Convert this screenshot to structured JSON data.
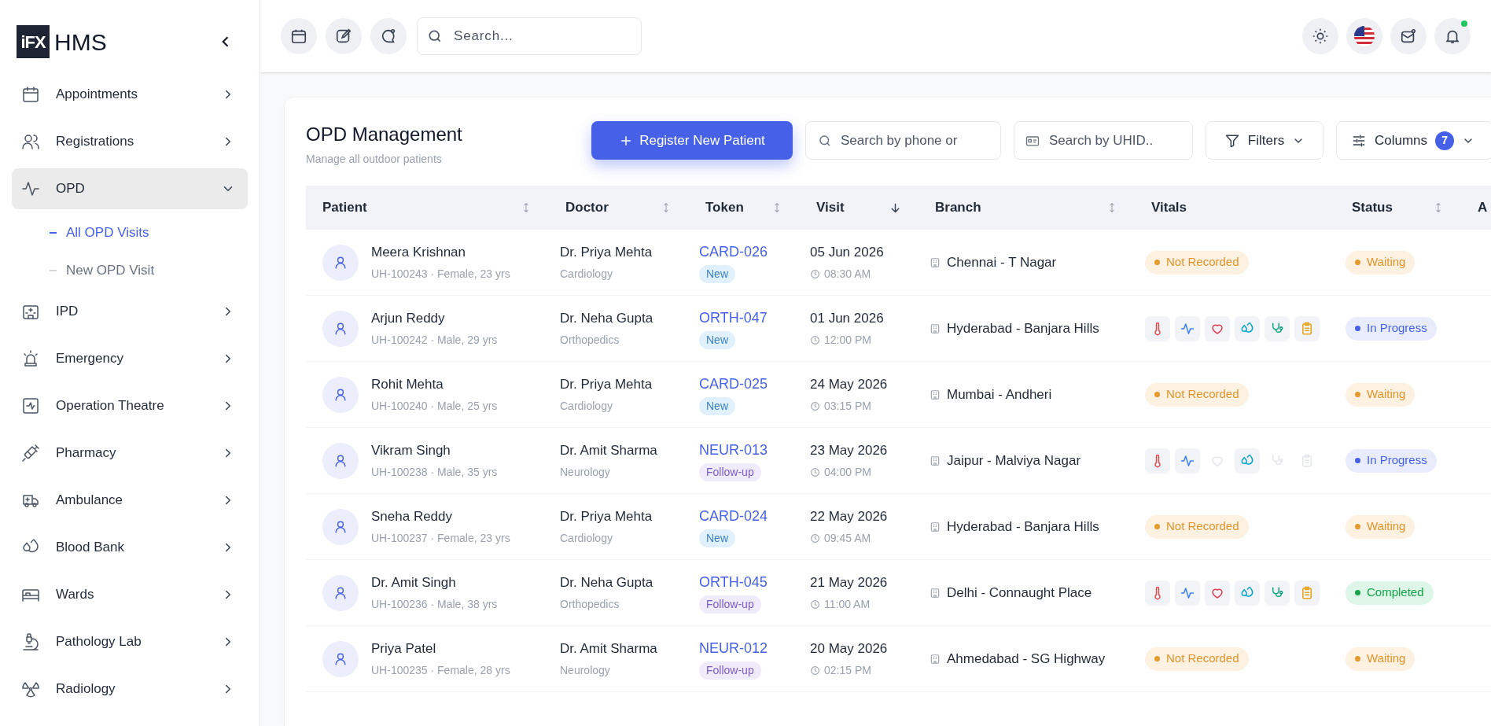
{
  "sidebar": {
    "logo_mark": "iFX",
    "logo_text": "HMS",
    "items": [
      {
        "label": "Appointments",
        "expanded": false
      },
      {
        "label": "Registrations",
        "expanded": false
      },
      {
        "label": "OPD",
        "expanded": true,
        "children": [
          {
            "label": "All OPD Visits",
            "selected": true
          },
          {
            "label": "New OPD Visit",
            "selected": false
          }
        ]
      },
      {
        "label": "IPD",
        "expanded": false
      },
      {
        "label": "Emergency",
        "expanded": false
      },
      {
        "label": "Operation Theatre",
        "expanded": false
      },
      {
        "label": "Pharmacy",
        "expanded": false
      },
      {
        "label": "Ambulance",
        "expanded": false
      },
      {
        "label": "Blood Bank",
        "expanded": false
      },
      {
        "label": "Wards",
        "expanded": false
      },
      {
        "label": "Pathology Lab",
        "expanded": false
      },
      {
        "label": "Radiology",
        "expanded": false
      }
    ]
  },
  "topbar": {
    "search": {
      "placeholder": "Search..."
    },
    "notification_dot": true
  },
  "page": {
    "title": "OPD Management",
    "subtitle": "Manage all outdoor patients",
    "register_button": "Register New Patient",
    "phone_search": {
      "placeholder": "Search by phone or"
    },
    "uhid_search": {
      "placeholder": "Search by UHID.."
    },
    "filters_button": "Filters",
    "columns_button": "Columns",
    "columns_count": "7"
  },
  "table": {
    "columns": [
      {
        "label": "Patient",
        "sortable": true,
        "sorted": false
      },
      {
        "label": "Doctor",
        "sortable": true,
        "sorted": false
      },
      {
        "label": "Token",
        "sortable": true,
        "sorted": false
      },
      {
        "label": "Visit",
        "sortable": true,
        "sorted": true
      },
      {
        "label": "Branch",
        "sortable": true,
        "sorted": false
      },
      {
        "label": "Vitals",
        "sortable": false,
        "sorted": false
      },
      {
        "label": "Status",
        "sortable": true,
        "sorted": false
      },
      {
        "label": "A",
        "sortable": false,
        "sorted": false
      }
    ],
    "rows": [
      {
        "name": "Meera Krishnan",
        "info": "UH-100243 · Female, 23 yrs",
        "doctor": "Dr. Priya Mehta",
        "department": "Cardiology",
        "token": "CARD-026",
        "visit_type": {
          "label": "New",
          "kind": "new"
        },
        "date": "05 Jun 2026",
        "time": "08:30 AM",
        "branch": "Chennai - T Nagar",
        "vitals": {
          "kind": "badge",
          "label": "Not Recorded"
        },
        "status": {
          "label": "Waiting",
          "kind": "waiting"
        }
      },
      {
        "name": "Arjun Reddy",
        "info": "UH-100242 · Male, 29 yrs",
        "doctor": "Dr. Neha Gupta",
        "department": "Orthopedics",
        "token": "ORTH-047",
        "visit_type": {
          "label": "New",
          "kind": "new"
        },
        "date": "01 Jun 2026",
        "time": "12:00 PM",
        "branch": "Hyderabad - Banjara Hills",
        "vitals": {
          "kind": "icons",
          "items": [
            {
              "recorded": true
            },
            {
              "recorded": true
            },
            {
              "recorded": true
            },
            {
              "recorded": true
            },
            {
              "recorded": true
            },
            {
              "recorded": true
            }
          ]
        },
        "status": {
          "label": "In Progress",
          "kind": "progress"
        }
      },
      {
        "name": "Rohit Mehta",
        "info": "UH-100240 · Male, 25 yrs",
        "doctor": "Dr. Priya Mehta",
        "department": "Cardiology",
        "token": "CARD-025",
        "visit_type": {
          "label": "New",
          "kind": "new"
        },
        "date": "24 May 2026",
        "time": "03:15 PM",
        "branch": "Mumbai - Andheri",
        "vitals": {
          "kind": "badge",
          "label": "Not Recorded"
        },
        "status": {
          "label": "Waiting",
          "kind": "waiting"
        }
      },
      {
        "name": "Vikram Singh",
        "info": "UH-100238 · Male, 35 yrs",
        "doctor": "Dr. Amit Sharma",
        "department": "Neurology",
        "token": "NEUR-013",
        "visit_type": {
          "label": "Follow-up",
          "kind": "followup"
        },
        "date": "23 May 2026",
        "time": "04:00 PM",
        "branch": "Jaipur - Malviya Nagar",
        "vitals": {
          "kind": "icons",
          "items": [
            {
              "recorded": true
            },
            {
              "recorded": true
            },
            {
              "recorded": false
            },
            {
              "recorded": true
            },
            {
              "recorded": false
            },
            {
              "recorded": false
            }
          ]
        },
        "status": {
          "label": "In Progress",
          "kind": "progress"
        }
      },
      {
        "name": "Sneha Reddy",
        "info": "UH-100237 · Female, 23 yrs",
        "doctor": "Dr. Priya Mehta",
        "department": "Cardiology",
        "token": "CARD-024",
        "visit_type": {
          "label": "New",
          "kind": "new"
        },
        "date": "22 May 2026",
        "time": "09:45 AM",
        "branch": "Hyderabad - Banjara Hills",
        "vitals": {
          "kind": "badge",
          "label": "Not Recorded"
        },
        "status": {
          "label": "Waiting",
          "kind": "waiting"
        }
      },
      {
        "name": "Dr. Amit Singh",
        "info": "UH-100236 · Male, 38 yrs",
        "doctor": "Dr. Neha Gupta",
        "department": "Orthopedics",
        "token": "ORTH-045",
        "visit_type": {
          "label": "Follow-up",
          "kind": "followup"
        },
        "date": "21 May 2026",
        "time": "11:00 AM",
        "branch": "Delhi - Connaught Place",
        "vitals": {
          "kind": "icons",
          "items": [
            {
              "recorded": true
            },
            {
              "recorded": true
            },
            {
              "recorded": true
            },
            {
              "recorded": true
            },
            {
              "recorded": true
            },
            {
              "recorded": true
            }
          ]
        },
        "status": {
          "label": "Completed",
          "kind": "completed"
        }
      },
      {
        "name": "Priya Patel",
        "info": "UH-100235 · Female, 28 yrs",
        "doctor": "Dr. Amit Sharma",
        "department": "Neurology",
        "token": "NEUR-012",
        "visit_type": {
          "label": "Follow-up",
          "kind": "followup"
        },
        "date": "20 May 2026",
        "time": "02:15 PM",
        "branch": "Ahmedabad - SG Highway",
        "vitals": {
          "kind": "badge",
          "label": "Not Recorded"
        },
        "status": {
          "label": "Waiting",
          "kind": "waiting"
        }
      }
    ]
  }
}
